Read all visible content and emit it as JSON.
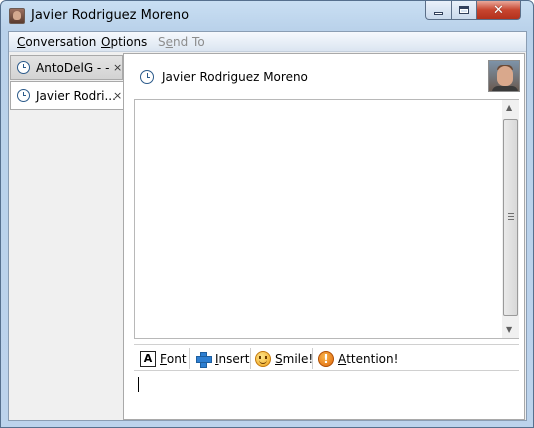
{
  "window": {
    "title": "Javier Rodriguez Moreno"
  },
  "menu": {
    "conversation": {
      "prefix": "",
      "mnemonic": "C",
      "rest": "onversation"
    },
    "options": {
      "mnemonic": "O",
      "rest": "ptions"
    },
    "send_to": {
      "prefix": "S",
      "mnemonic": "e",
      "rest": "nd To"
    }
  },
  "tabs": [
    {
      "label": "AntoDelG - -",
      "close": "×",
      "icon": "clock-status-icon",
      "active": false
    },
    {
      "label": "Javier Rodri...",
      "close": "×",
      "icon": "clock-status-icon",
      "active": true
    }
  ],
  "contact": {
    "name": "Javier Rodriguez Moreno",
    "status_icon": "clock-status-icon",
    "avatar": "contact-photo"
  },
  "toolbar": {
    "font": {
      "icon_letter": "A",
      "mnemonic": "F",
      "rest": "ont"
    },
    "insert": {
      "mnemonic": "I",
      "rest": "nsert"
    },
    "smile": {
      "mnemonic": "S",
      "rest": "mile!"
    },
    "attention": {
      "icon_glyph": "!",
      "mnemonic": "A",
      "rest": "ttention!"
    }
  },
  "input": {
    "value": ""
  }
}
